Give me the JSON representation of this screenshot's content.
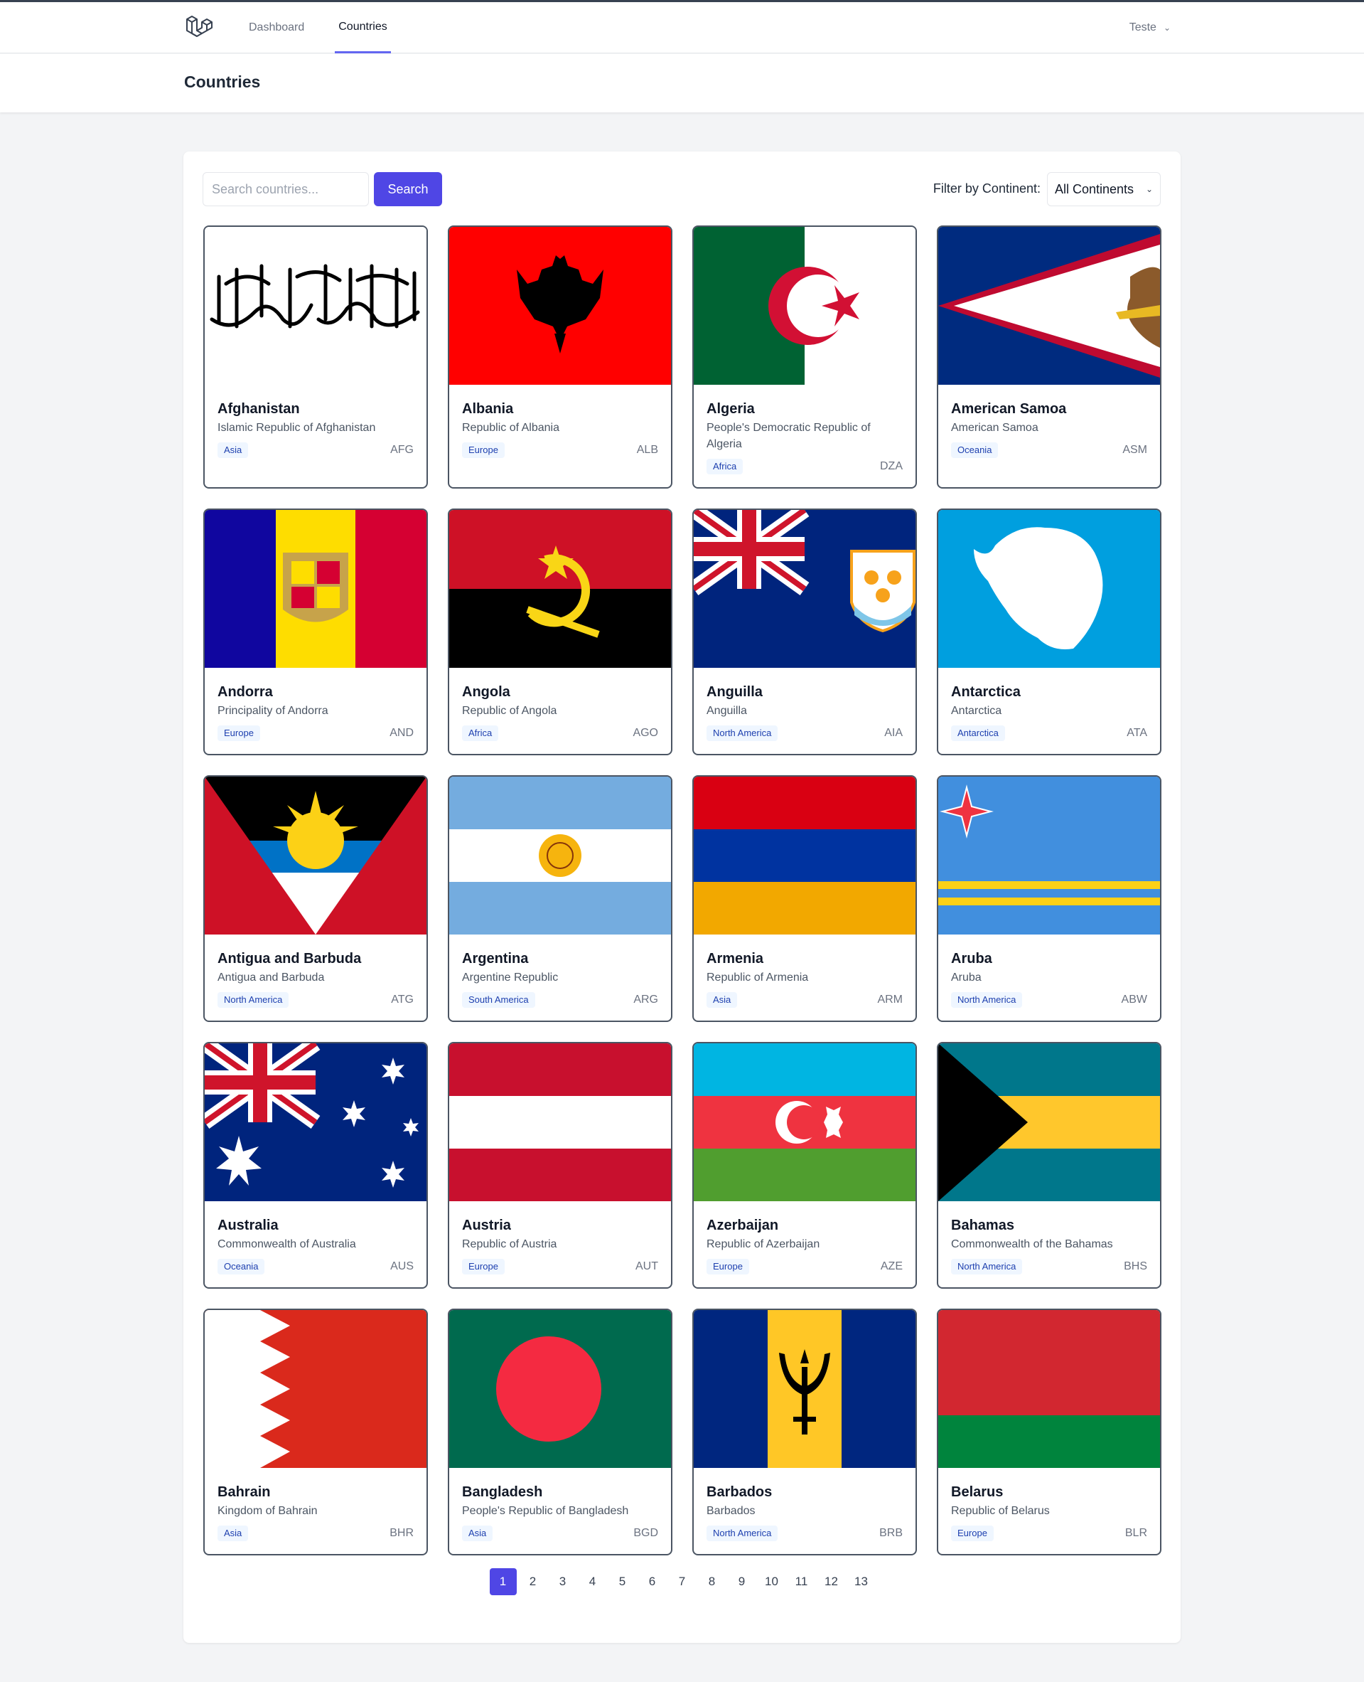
{
  "nav": {
    "links": [
      "Dashboard",
      "Countries"
    ],
    "active": "Countries",
    "user": "Teste"
  },
  "header": {
    "title": "Countries"
  },
  "search": {
    "placeholder": "Search countries...",
    "value": "",
    "button": "Search"
  },
  "filter": {
    "label": "Filter by Continent:",
    "selected": "All Continents"
  },
  "countries": [
    {
      "name": "Afghanistan",
      "official": "Islamic Republic of Afghanistan",
      "continent": "Asia",
      "code": "AFG"
    },
    {
      "name": "Albania",
      "official": "Republic of Albania",
      "continent": "Europe",
      "code": "ALB"
    },
    {
      "name": "Algeria",
      "official": "People's Democratic Republic of Algeria",
      "continent": "Africa",
      "code": "DZA"
    },
    {
      "name": "American Samoa",
      "official": "American Samoa",
      "continent": "Oceania",
      "code": "ASM"
    },
    {
      "name": "Andorra",
      "official": "Principality of Andorra",
      "continent": "Europe",
      "code": "AND"
    },
    {
      "name": "Angola",
      "official": "Republic of Angola",
      "continent": "Africa",
      "code": "AGO"
    },
    {
      "name": "Anguilla",
      "official": "Anguilla",
      "continent": "North America",
      "code": "AIA"
    },
    {
      "name": "Antarctica",
      "official": "Antarctica",
      "continent": "Antarctica",
      "code": "ATA"
    },
    {
      "name": "Antigua and Barbuda",
      "official": "Antigua and Barbuda",
      "continent": "North America",
      "code": "ATG"
    },
    {
      "name": "Argentina",
      "official": "Argentine Republic",
      "continent": "South America",
      "code": "ARG"
    },
    {
      "name": "Armenia",
      "official": "Republic of Armenia",
      "continent": "Asia",
      "code": "ARM"
    },
    {
      "name": "Aruba",
      "official": "Aruba",
      "continent": "North America",
      "code": "ABW"
    },
    {
      "name": "Australia",
      "official": "Commonwealth of Australia",
      "continent": "Oceania",
      "code": "AUS"
    },
    {
      "name": "Austria",
      "official": "Republic of Austria",
      "continent": "Europe",
      "code": "AUT"
    },
    {
      "name": "Azerbaijan",
      "official": "Republic of Azerbaijan",
      "continent": "Europe",
      "code": "AZE"
    },
    {
      "name": "Bahamas",
      "official": "Commonwealth of the Bahamas",
      "continent": "North America",
      "code": "BHS"
    },
    {
      "name": "Bahrain",
      "official": "Kingdom of Bahrain",
      "continent": "Asia",
      "code": "BHR"
    },
    {
      "name": "Bangladesh",
      "official": "People's Republic of Bangladesh",
      "continent": "Asia",
      "code": "BGD"
    },
    {
      "name": "Barbados",
      "official": "Barbados",
      "continent": "North America",
      "code": "BRB"
    },
    {
      "name": "Belarus",
      "official": "Republic of Belarus",
      "continent": "Europe",
      "code": "BLR"
    }
  ],
  "pagination": {
    "pages": [
      "1",
      "2",
      "3",
      "4",
      "5",
      "6",
      "7",
      "8",
      "9",
      "10",
      "11",
      "12",
      "13"
    ],
    "current": "1"
  }
}
